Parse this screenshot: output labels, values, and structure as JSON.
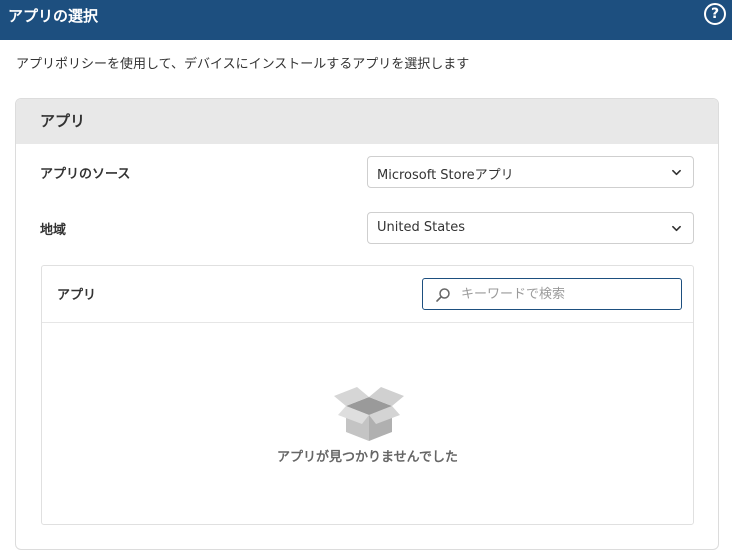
{
  "header": {
    "title": "アプリの選択",
    "help_icon": "help-circle-icon",
    "color": "#1d4f7f"
  },
  "description": "アプリポリシーを使用して、デバイスにインストールするアプリを選択します",
  "panel": {
    "title": "アプリ",
    "source": {
      "label": "アプリのソース",
      "value": "Microsoft Storeアプリ"
    },
    "region": {
      "label": "地域",
      "value": "United States"
    },
    "apps": {
      "title": "アプリ",
      "search_placeholder": "キーワードで検索",
      "search_icon": "search-icon",
      "empty_icon": "empty-box-icon",
      "empty_message": "アプリが見つかりませんでした"
    }
  }
}
